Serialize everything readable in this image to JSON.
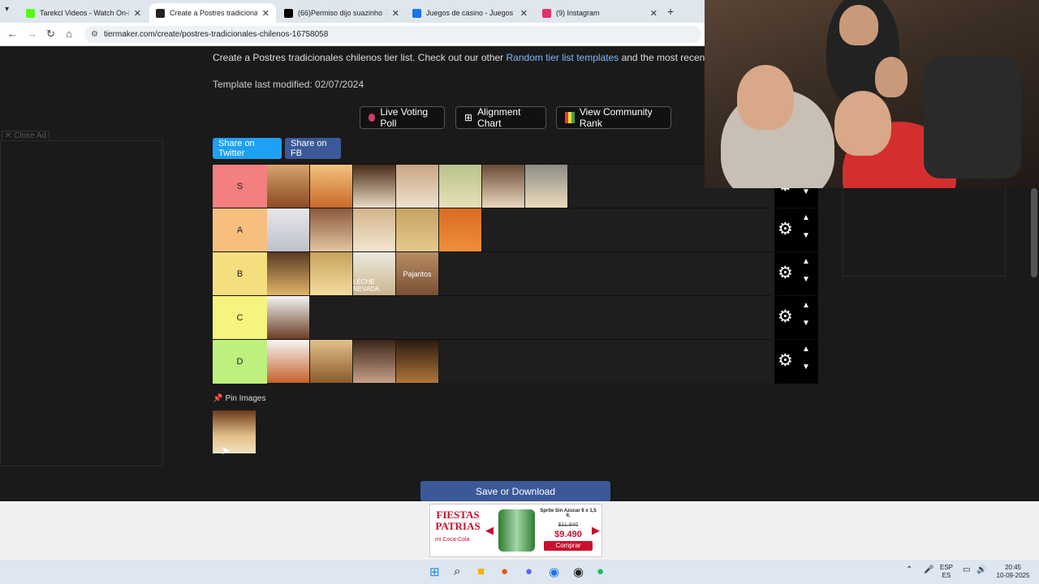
{
  "browser": {
    "tabs": [
      {
        "title": "Tarekcl Videos - Watch On-Dem",
        "favicon_color": "#53fc18"
      },
      {
        "title": "Create a Postres tradicionales c",
        "favicon_color": "#222222"
      },
      {
        "title": "(66)Permiso dijo suazinho 🎖️🔥",
        "favicon_color": "#000000"
      },
      {
        "title": "Juegos de casino - Juegos de c",
        "favicon_color": "#1a73e8"
      },
      {
        "title": "(9) Instagram",
        "favicon_color": "#e1306c"
      }
    ],
    "url": "tiermaker.com/create/postres-tradicionales-chilenos-16758058"
  },
  "page": {
    "intro_text": "Create a Postres tradicionales chilenos tier list. Check out our other ",
    "intro_link": "Random tier list templates",
    "intro_tail": " and the most recent user s",
    "modified": "Template last modified: 02/07/2024",
    "buttons": {
      "live_voting": "Live Voting Poll",
      "alignment": "Alignment Chart",
      "community": "View Community Rank"
    },
    "share": {
      "twitter": "Share on Twitter",
      "fb": "Share on FB"
    },
    "close_ad": "✕ Close Ad",
    "pin_label": "Pin Images",
    "save_button": "Save or Download"
  },
  "tiers": [
    {
      "label": "S",
      "color": "#f37f7f",
      "image_count": 7,
      "captions": [
        "",
        "",
        "",
        "",
        "",
        "",
        ""
      ]
    },
    {
      "label": "A",
      "color": "#f6bf7e",
      "image_count": 5,
      "captions": [
        "",
        "",
        "",
        "",
        ""
      ]
    },
    {
      "label": "B",
      "color": "#f5de7e",
      "image_count": 4,
      "captions": [
        "",
        "",
        "LECHE NEVADA",
        "Pajaritos"
      ]
    },
    {
      "label": "C",
      "color": "#f5f47e",
      "image_count": 1,
      "captions": [
        ""
      ]
    },
    {
      "label": "D",
      "color": "#bef07e",
      "image_count": 4,
      "captions": [
        "",
        "",
        "",
        ""
      ]
    }
  ],
  "ad": {
    "brand": "FIESTAS PATRIAS",
    "sub": "mi Coca-Cola",
    "product": "Sprite Sin Azucar 6 x 1,5 lt.",
    "old_price": "$11.940",
    "price": "$9.490",
    "buy": "Comprar"
  },
  "taskbar": {
    "lang": "ESP",
    "lang_sub": "ES",
    "time": "20:45",
    "date": "10-09-2025"
  },
  "icons": [
    "tab-menu-icon",
    "back-icon",
    "forward-icon",
    "reload-icon",
    "home-icon",
    "site-info-icon",
    "gear-icon",
    "chevron-up-icon",
    "chevron-down-icon",
    "pin-icon",
    "windows-icon",
    "search-icon",
    "folder-icon",
    "chrome-icon"
  ]
}
